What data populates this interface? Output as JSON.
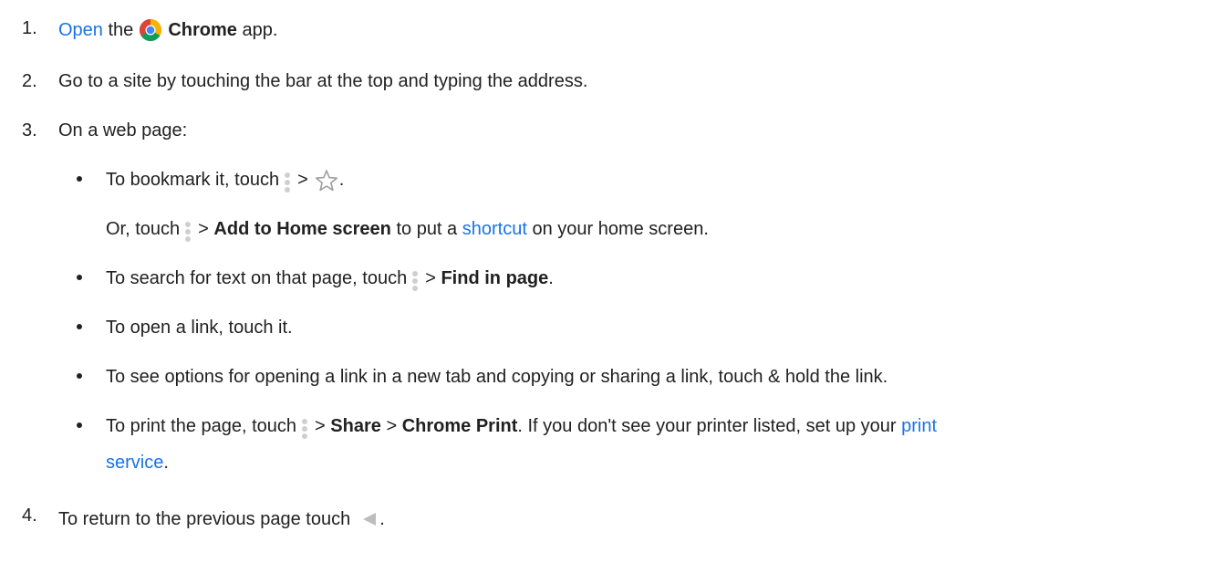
{
  "steps": {
    "s1": {
      "num": "1.",
      "open_link": "Open",
      "t1": "the",
      "chrome": "Chrome",
      "t2": "app."
    },
    "s2": {
      "num": "2.",
      "text": "Go to a site by touching the bar at the top and typing the address."
    },
    "s3": {
      "num": "3.",
      "text": "On a web page:"
    },
    "s4": {
      "num": "4.",
      "text": "To return to the previous page touch",
      "end": "."
    }
  },
  "bullets": {
    "b1": {
      "text": "To bookmark it, touch",
      "sep": ">",
      "end": "."
    },
    "b1_or": {
      "t1": "Or, touch",
      "sep": ">",
      "bold": "Add to Home screen",
      "t2": "to put a",
      "link": "shortcut",
      "t3": "on your home screen."
    },
    "b2": {
      "text": "To search for text on that page, touch",
      "sep": ">",
      "bold": "Find in page",
      "end": "."
    },
    "b3": {
      "text": "To open a link, touch it."
    },
    "b4": {
      "text": "To see options for opening a link in a new tab and copying or sharing a link, touch & hold the link."
    },
    "b5": {
      "text": "To print the page, touch",
      "sep1": ">",
      "bold1": "Share",
      "sep2": ">",
      "bold2": "Chrome Print",
      "t2": ". If you don't see your printer listed, set up your",
      "link1": "print",
      "link2": "service",
      "end": "."
    }
  },
  "icons": {
    "chrome": "chrome-icon",
    "menu": "more-vert-icon",
    "star": "star-outline-icon",
    "back": "back-triangle-icon"
  },
  "colors": {
    "link": "#1a73e8",
    "text": "#212121",
    "icon_gray": "#cfcfcf"
  }
}
